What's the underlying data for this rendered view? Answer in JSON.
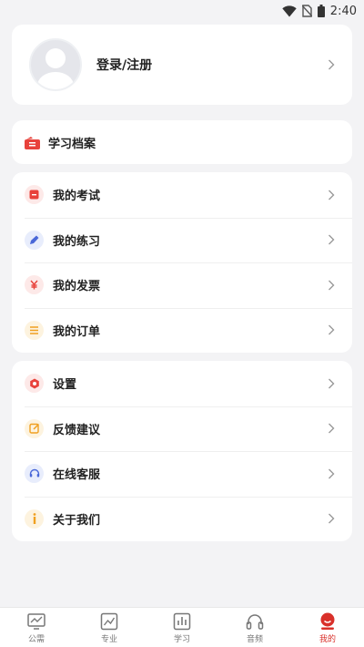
{
  "status_bar": {
    "time": "2:40"
  },
  "profile": {
    "login_label": "登录/注册"
  },
  "archive": {
    "label": "学习档案"
  },
  "menu_group_1": [
    {
      "label": "我的考试",
      "icon": "exam-icon",
      "color": "#e8423b",
      "bg": "#fde9e8"
    },
    {
      "label": "我的练习",
      "icon": "practice-icon",
      "color": "#4a68d8",
      "bg": "#e8edfc"
    },
    {
      "label": "我的发票",
      "icon": "invoice-icon",
      "color": "#e8423b",
      "bg": "#fde9e8"
    },
    {
      "label": "我的订单",
      "icon": "order-icon",
      "color": "#f0a020",
      "bg": "#fdf3df"
    }
  ],
  "menu_group_2": [
    {
      "label": "设置",
      "icon": "settings-icon",
      "color": "#e8423b",
      "bg": "#fde9e8"
    },
    {
      "label": "反馈建议",
      "icon": "feedback-icon",
      "color": "#f0a020",
      "bg": "#fdf3df"
    },
    {
      "label": "在线客服",
      "icon": "support-icon",
      "color": "#4a68d8",
      "bg": "#e8edfc"
    },
    {
      "label": "关于我们",
      "icon": "info-icon",
      "color": "#f0a020",
      "bg": "#fdf3df"
    }
  ],
  "tabs": [
    {
      "label": "公需",
      "icon": "monitor-icon",
      "active": false
    },
    {
      "label": "专业",
      "icon": "chart-icon",
      "active": false
    },
    {
      "label": "学习",
      "icon": "bars-icon",
      "active": false
    },
    {
      "label": "音频",
      "icon": "headphones-icon",
      "active": false
    },
    {
      "label": "我的",
      "icon": "user-icon",
      "active": true
    }
  ],
  "colors": {
    "accent": "#d9302a",
    "background": "#f3f3f5"
  }
}
